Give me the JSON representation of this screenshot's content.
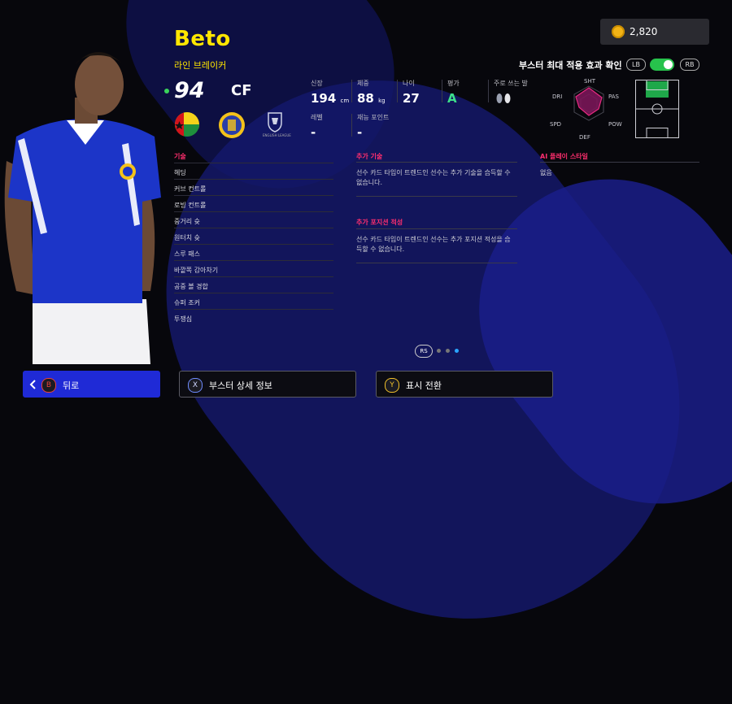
{
  "player": {
    "name": "Beto",
    "role": "라인 브레이커",
    "rating": "94",
    "position": "CF"
  },
  "stats": {
    "height_label": "신장",
    "height_value": "194",
    "height_unit": "cm",
    "weight_label": "체중",
    "weight_value": "88",
    "weight_unit": "kg",
    "age_label": "나이",
    "age_value": "27",
    "grade_label": "평가",
    "grade_value": "A",
    "foot_label": "주로 쓰는 발",
    "level_label": "레벨",
    "level_value": "-",
    "talent_label": "재능 포인트",
    "talent_value": "-"
  },
  "skills": {
    "title": "기술",
    "items": [
      "헤딩",
      "커브 컨트롤",
      "로빙 컨트롤",
      "중거리 슛",
      "원터치 슛",
      "스루 패스",
      "바깥쪽 감아차기",
      "공중 볼 경합",
      "슈퍼 조커",
      "투쟁심"
    ]
  },
  "additional_skills": {
    "title": "추가 기술",
    "desc": "선수 카드 타입이 트렌드인 선수는 추가 기술을 습득할 수 없습니다."
  },
  "additional_positions": {
    "title": "추가 포지션 적성",
    "desc": "선수 카드 타입이 트렌드인 선수는 추가 포지션 적성을 습득할 수 없습니다."
  },
  "ai_style": {
    "title": "AI 플레이 스타일",
    "value": "없음"
  },
  "currency": {
    "amount": "2,820"
  },
  "booster": {
    "label": "부스터 최대 적용 효과 확인",
    "lb": "LB",
    "rb": "RB",
    "enabled": true
  },
  "radar": {
    "labels": [
      "SHT",
      "PAS",
      "POW",
      "DEF",
      "SPD",
      "DRI"
    ]
  },
  "league_caption": "ENGLISH LEAGUE",
  "pager": {
    "rs": "RS",
    "pages": 3,
    "current": 3
  },
  "footer": {
    "back": {
      "key": "B",
      "label": "뒤로"
    },
    "detail": {
      "key": "X",
      "label": "부스터 상세 정보"
    },
    "toggle": {
      "key": "Y",
      "label": "표시 전환"
    }
  },
  "colors": {
    "accent": "#ffe600",
    "section": "#ff2e6e",
    "primary": "#1f2ad6",
    "toggle": "#27c24c"
  }
}
